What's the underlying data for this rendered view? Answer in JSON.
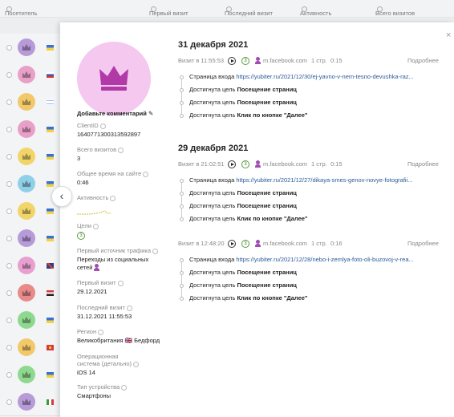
{
  "header": {
    "visitor": "Посетитель",
    "first_visit": "Первый визит",
    "last_visit": "Последний визит",
    "activity": "Активность",
    "total_visits": "Всего визитов"
  },
  "rows": [
    {
      "avatar_color": "#b79ad8",
      "flag": "ua"
    },
    {
      "avatar_color": "#e8a0c8",
      "flag": "ru"
    },
    {
      "avatar_color": "#f2c96a",
      "flag": "il"
    },
    {
      "avatar_color": "#e8a0c8",
      "flag": "ua"
    },
    {
      "avatar_color": "#f2d56a",
      "flag": "ua"
    },
    {
      "avatar_color": "#8fd0e8",
      "flag": "ua"
    },
    {
      "avatar_color": "#f2d56a",
      "flag": "ua"
    },
    {
      "avatar_color": "#b79ad8",
      "flag": "ua"
    },
    {
      "avatar_color": "#e8a0d0",
      "flag": "gb"
    },
    {
      "avatar_color": "#e88a8a",
      "flag": "eg"
    },
    {
      "avatar_color": "#8fd890",
      "flag": "ua"
    },
    {
      "avatar_color": "#f2c96a",
      "flag": "mk"
    },
    {
      "avatar_color": "#8fd890",
      "flag": "ua"
    },
    {
      "avatar_color": "#b79ad8",
      "flag": "it"
    }
  ],
  "profile": {
    "comment": "Добавьте комментарий",
    "client_id_label": "ClientID",
    "client_id": "1640771300313592897",
    "total_visits_label": "Всего визитов",
    "total_visits": "3",
    "total_time_label": "Общее время на сайте",
    "total_time": "0:46",
    "activity_label": "Активность",
    "goals_label": "Цели",
    "goals": "3",
    "first_source_label": "Первый источник трафика",
    "first_source": "Переходы из социальных сетей",
    "first_visit_label": "Первый визит",
    "first_visit": "29.12.2021",
    "last_visit_label": "Последний визит",
    "last_visit": "31.12.2021 11:55:53",
    "region_label": "Регион",
    "region": "Великобритания 🇬🇧 Бедфорд",
    "os_label": "Операционная система (детально)",
    "os": "iOS 14",
    "device_label": "Тип устройства",
    "device": "Смартфоны"
  },
  "days": [
    {
      "date": "31 декабря 2021",
      "visits": [
        {
          "time": "Визит в 11:55:53",
          "goals": "3",
          "source": "m.facebook.com",
          "pages": "1 стр.",
          "duration": "0:15",
          "more": "Подробнее",
          "events": [
            {
              "prefix": "Страница входа ",
              "text": "https://yubiter.ru/2021/12/30/ej-yavno-v-nem-tesno-devushka-raz..."
            },
            {
              "prefix": "Достигнута цель ",
              "text": "Посещение страниц"
            },
            {
              "prefix": "Достигнута цель ",
              "text": "Посещение страниц"
            },
            {
              "prefix": "Достигнута цель ",
              "text": "Клик по кнопке \"Далее\""
            }
          ]
        }
      ]
    },
    {
      "date": "29 декабря 2021",
      "visits": [
        {
          "time": "Визит в 21:02:51",
          "goals": "3",
          "source": "m.facebook.com",
          "pages": "1 стр.",
          "duration": "0:15",
          "more": "Подробнее",
          "events": [
            {
              "prefix": "Страница входа ",
              "text": "https://yubiter.ru/2021/12/27/dikaya-smes-genov-novye-fotografii..."
            },
            {
              "prefix": "Достигнута цель ",
              "text": "Посещение страниц"
            },
            {
              "prefix": "Достигнута цель ",
              "text": "Посещение страниц"
            },
            {
              "prefix": "Достигнута цель ",
              "text": "Клик по кнопке \"Далее\""
            }
          ]
        },
        {
          "time": "Визит в 12:48:20",
          "goals": "3",
          "source": "m.facebook.com",
          "pages": "1 стр.",
          "duration": "0:16",
          "more": "Подробнее",
          "events": [
            {
              "prefix": "Страница входа ",
              "text": "https://yubiter.ru/2021/12/28/nebo-i-zemlya-foto-oli-buzovoj-v-rea..."
            },
            {
              "prefix": "Достигнута цель ",
              "text": "Посещение страниц"
            },
            {
              "prefix": "Достигнута цель ",
              "text": "Посещение страниц"
            },
            {
              "prefix": "Достигнута цель ",
              "text": "Клик по кнопке \"Далее\""
            }
          ]
        }
      ]
    }
  ],
  "icons": {
    "avatar_crown_color": "#b23aa8",
    "avatar_bg": "#f4c8ef",
    "goal_color": "#5a9a3a",
    "link_color": "#2a5b9a"
  }
}
